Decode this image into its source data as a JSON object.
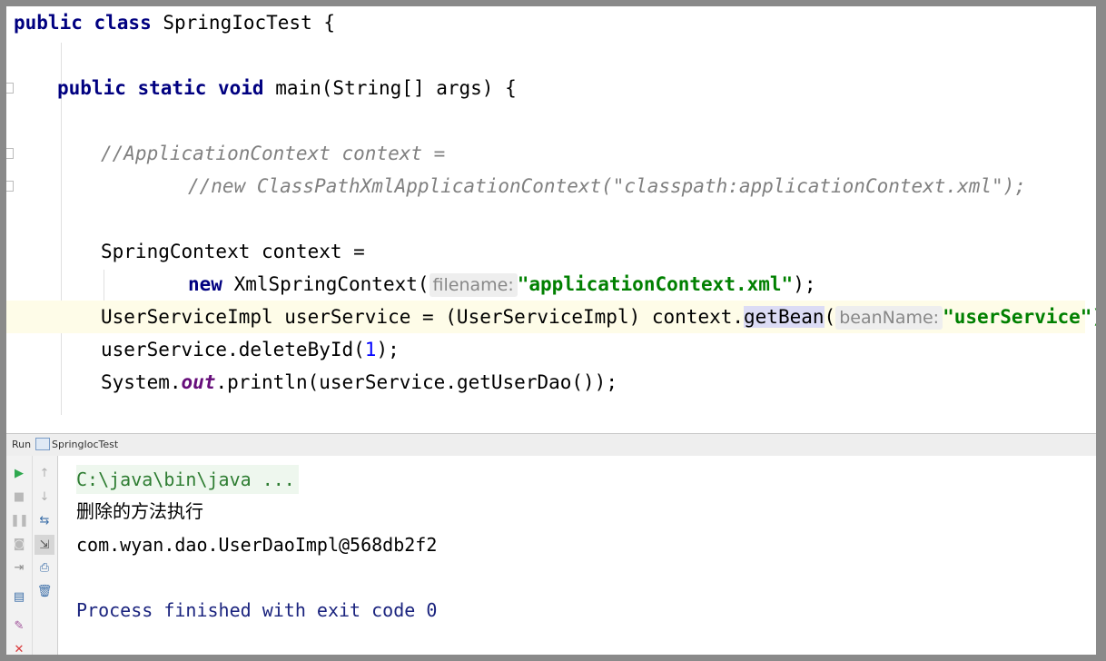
{
  "editor": {
    "line1": {
      "kw": "public class",
      "rest": " SpringIocTest {"
    },
    "line2": {
      "kw": "public static void",
      "rest": " main(String[] args) {"
    },
    "line3": "//ApplicationContext context =",
    "line4": "//new ClassPathXmlApplicationContext(\"classpath:applicationContext.xml\");",
    "line5": "SpringContext context =",
    "line6": {
      "kw": "new",
      "rest": " XmlSpringContext(",
      "hint": "filename:",
      "str": "\"applicationContext.xml\"",
      "end": ");"
    },
    "line7": {
      "pre": "UserServiceImpl userService = (UserServiceImpl) context.",
      "method": "getBean",
      "paren": "(",
      "hint": "beanName:",
      "str": "\"userService\")"
    },
    "line8": {
      "pre": "userService.deleteById(",
      "num": "1",
      "end": ");"
    },
    "line9": {
      "pre": "System.",
      "field": "out",
      "end": ".println(userService.getUserDao());"
    }
  },
  "run_panel": {
    "label": "Run",
    "config_name": "SpringIocTest"
  },
  "console": {
    "command": "C:\\java\\bin\\java ...",
    "output_1": "删除的方法执行",
    "output_2": "com.wyan.dao.UserDaoImpl@568db2f2",
    "finished": "Process finished with exit code 0"
  },
  "toolbar_icons": [
    "run-icon",
    "stop-icon",
    "pause-icon",
    "camera-icon",
    "login-icon",
    "layout-icon",
    "pin-icon",
    "close-icon",
    "up-arrow-icon",
    "down-arrow-icon",
    "wrap-icon",
    "scroll-to-end-icon",
    "print-icon",
    "trash-icon"
  ],
  "colors": {
    "keyword": "#000080",
    "string": "#008000",
    "comment": "#808080",
    "number": "#0000ff",
    "field": "#660e7a",
    "console_command": "#2e7d32",
    "console_finished": "#1a237e"
  }
}
